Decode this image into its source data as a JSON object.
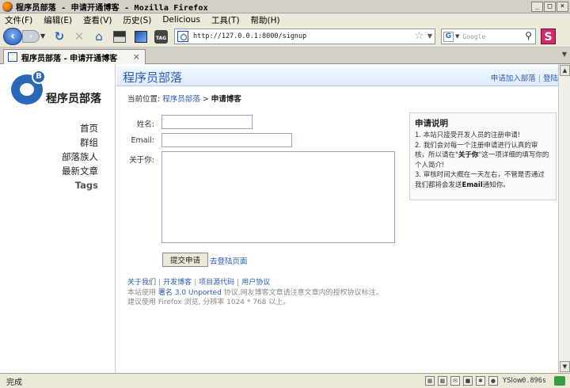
{
  "window": {
    "title": "程序员部落 - 申请开通博客 - Mozilla Firefox",
    "controls": [
      "_",
      "□",
      "×"
    ]
  },
  "menu": [
    "文件(F)",
    "编辑(E)",
    "查看(V)",
    "历史(S)",
    "Delicious",
    "工具(T)",
    "帮助(H)"
  ],
  "nav": {
    "url": "http://127.0.0.1:8000/signup",
    "search_placeholder": "Google",
    "tag_label": "TAG"
  },
  "tab": {
    "label": "程序员部落 - 申请开通博客",
    "close": "×"
  },
  "sidebar": {
    "logo_text": "程序员部落",
    "logo_letter": "B",
    "items": [
      "首页",
      "群组",
      "部落族人",
      "最新文章",
      "Tags"
    ]
  },
  "header": {
    "title": "程序员部落",
    "apply_link": "申请加入部落",
    "separator": "|",
    "login_link": "登陆"
  },
  "breadcrumb": {
    "prefix": "当前位置:",
    "home": "程序员部落",
    "arrow": ">",
    "current": "申请博客"
  },
  "form": {
    "name_label": "姓名:",
    "email_label": "Email:",
    "about_label": "关于你:",
    "name_value": "",
    "email_value": "",
    "about_value": "",
    "submit_label": "提交申请",
    "login_link": "去登陆页面"
  },
  "notice": {
    "title": "申请说明",
    "p1": "1. 本站只接受开发人员的注册申请!",
    "p2_pre": "2. 我们会对每一个注册申请进行认真的审核，所以请在\"",
    "p2_bold": "关于你",
    "p2_post": "\"这一项详细的填写你的个人简介!",
    "p3_pre": "3. 审核时间大概在一天左右，不管是否通过我们都将会发送",
    "p3_bold": "Email",
    "p3_post": "通知你。"
  },
  "footer": {
    "links": [
      "关于我们",
      "开发博客",
      "项目源代码",
      "用户协议"
    ],
    "line2_pre": "本站使用 ",
    "line2_license": "署名 3.0 Unported",
    "line2_post": " 协议,网友博客文章请注意文章内的授权协议标注。",
    "line3": "建议使用 Firefox 浏览, 分辨率 1024 * 768 以上。"
  },
  "status": {
    "text": "完成",
    "yslow": "YSlow",
    "timing": "0.896s"
  },
  "colors": {
    "link": "#2a5ab5",
    "header_bg": "#dfeafc",
    "logo": "#2a67b8"
  }
}
